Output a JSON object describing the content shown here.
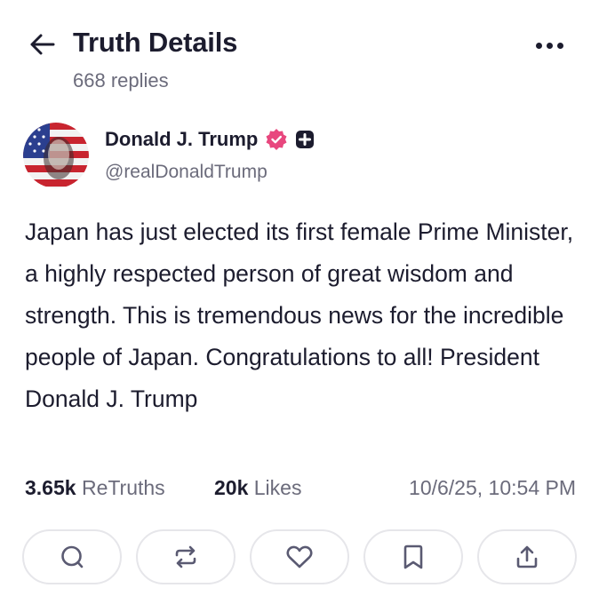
{
  "header": {
    "back_icon": "arrow-left-icon",
    "title": "Truth Details",
    "subtitle": "668 replies",
    "more_icon": "more-horizontal-icon"
  },
  "author": {
    "name": "Donald J. Trump",
    "handle": "@realDonaldTrump",
    "verified_icon": "verified-check-icon",
    "badge_icon": "plus-badge-icon",
    "verified_color": "#e8477e"
  },
  "post": {
    "text": "Japan has just elected its first female Prime Minister, a highly respected person of great wisdom and strength. This is tremendous news for the incredible people of Japan. Congratulations to all! President Donald J. Trump"
  },
  "stats": {
    "retruths_count": "3.65k",
    "retruths_label": "ReTruths",
    "likes_count": "20k",
    "likes_label": "Likes",
    "timestamp": "10/6/25, 10:54 PM"
  },
  "actions": [
    {
      "icon": "reply-icon"
    },
    {
      "icon": "retruth-icon"
    },
    {
      "icon": "like-heart-icon"
    },
    {
      "icon": "bookmark-icon"
    },
    {
      "icon": "share-icon"
    }
  ]
}
